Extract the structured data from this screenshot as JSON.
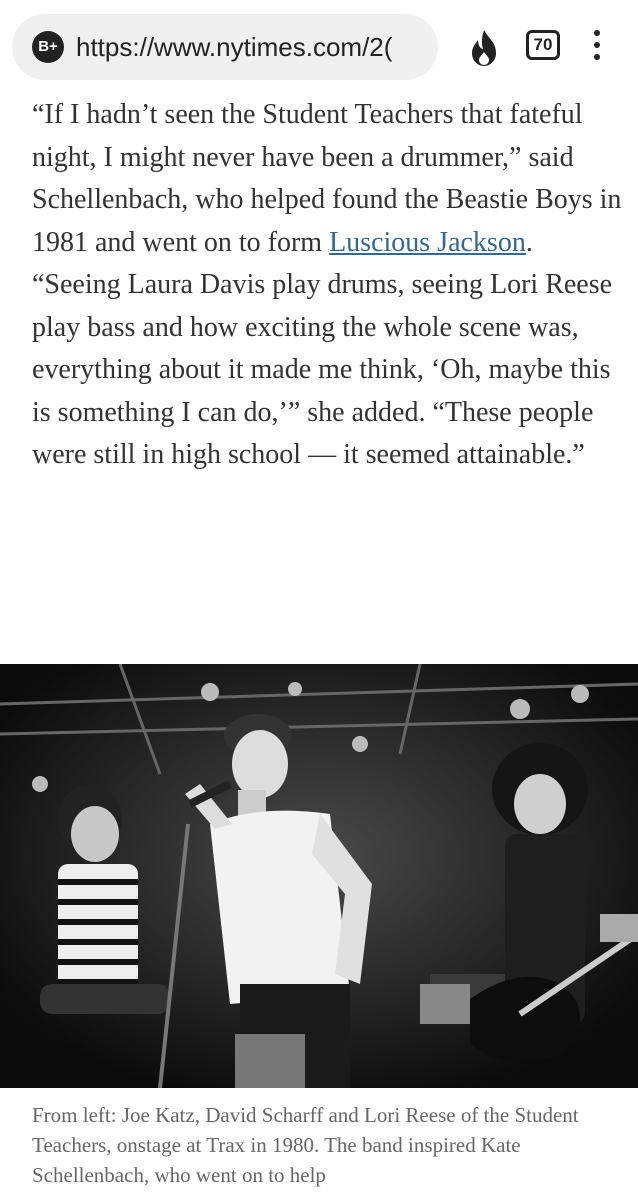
{
  "browser": {
    "badge": "B+",
    "url": "https://www.nytimes.com/2(",
    "tab_count": "70",
    "icons": [
      "b-plus-icon",
      "fire-icon",
      "tabs-icon",
      "menu-icon"
    ]
  },
  "article": {
    "paragraph_1_before": "“If I hadn’t seen the Student Teachers that fateful night, I might never have been a drummer,” said Schellenbach, who helped found the Beastie Boys in 1981 and went on to form ",
    "link_text": "Luscious Jackson",
    "paragraph_1_after": ".",
    "paragraph_2": "“Seeing Laura Davis play drums, seeing Lori Reese play bass and how exciting the whole scene was, everything about it made me think, ‘Oh, maybe this is something I can do,’” she added. “These people were still in high school — it seemed attainable.”"
  },
  "photo": {
    "caption": "From left: Joe Katz, David Scharff and Lori Reese of the Student Teachers, onstage at Trax in 1980. The band inspired Kate Schellenbach, who went on to help"
  },
  "colors": {
    "link": "#326891",
    "text": "#333333",
    "caption": "#666666"
  }
}
